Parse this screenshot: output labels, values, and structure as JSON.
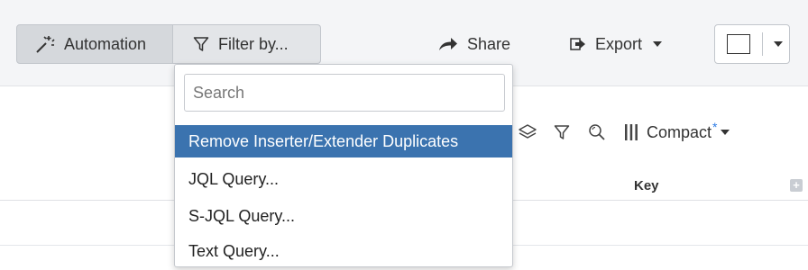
{
  "toolbar": {
    "automation_label": "Automation",
    "filter_label": "Filter by...",
    "share_label": "Share",
    "export_label": "Export"
  },
  "sub_tools": {
    "compact_label": "Compact",
    "compact_marker": "*"
  },
  "table": {
    "columns": [
      "Key"
    ],
    "add_column_symbol": "+"
  },
  "filter_menu": {
    "search_placeholder": "Search",
    "search_value": "",
    "items": [
      "Remove Inserter/Extender Duplicates",
      "JQL Query...",
      "S-JQL Query...",
      "Text Query..."
    ],
    "active_index": 0
  },
  "icons": {
    "automation": "magic-wand-icon",
    "filter": "filter-funnel-icon",
    "share": "share-arrow-icon",
    "export": "export-icon",
    "layers": "layers-icon",
    "funnel": "filter-funnel-icon",
    "search": "magnifier-icon",
    "compact": "columns-icon"
  },
  "colors": {
    "accent": "#3b73af",
    "marker": "#2d7be5"
  }
}
